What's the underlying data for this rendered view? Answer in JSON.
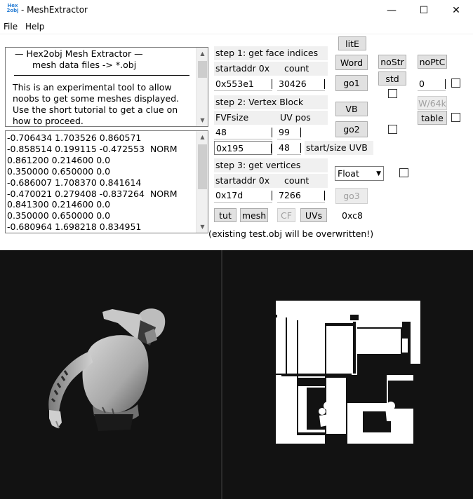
{
  "window": {
    "title": "- MeshExtractor",
    "icon_lines": [
      "Hex",
      "2obj"
    ],
    "controls": [
      "—",
      "☐",
      "✕"
    ]
  },
  "menu": {
    "items": [
      "File",
      "Help"
    ]
  },
  "info": {
    "heading": "—   Hex2obj Mesh Extractor   —",
    "subheading": "mesh data files -> *.obj",
    "body_lines": [
      "This is an experimental tool to allow",
      "noobs to get some meshes displayed.",
      "Use the short tutorial to get a clue on",
      "how to proceed."
    ]
  },
  "data_list": {
    "lines": [
      "-0.706434 1.703526 0.860571",
      "-0.858514 0.199115 -0.472553  NORM",
      "0.861200 0.214600 0.0",
      "0.350000 0.650000 0.0",
      "-0.686007 1.708370 0.841614",
      "-0.470021 0.279408 -0.837264  NORM",
      "0.841300 0.214600 0.0",
      "0.350000 0.650000 0.0",
      "-0.680964 1.698218 0.834951"
    ]
  },
  "step1": {
    "label": "step 1: get face indices",
    "addr_label": "startaddr 0x",
    "count_label": "count",
    "addr_value": "0x553e1",
    "count_value": "30426"
  },
  "step2": {
    "label": "step 2: Vertex Block",
    "fvf_label": "FVFsize",
    "uv_label": "UV pos",
    "fvf_value": "48",
    "uv_value": "99",
    "uvb_start_value": "0x195",
    "uvb_size_value": "48",
    "uvb_label": "start/size UVB"
  },
  "step3": {
    "label": "step 3: get vertices",
    "addr_label": "startaddr 0x",
    "count_label": "count",
    "addr_value": "0x17d",
    "count_value": "7266",
    "format_value": "Float"
  },
  "buttons": {
    "lite": "litE",
    "word": "Word",
    "go1": "go1",
    "vb": "VB",
    "go2": "go2",
    "go3": "go3",
    "nostr": "noStr",
    "std": "std",
    "noptc": "noPtC",
    "w64k": "W/64k",
    "table": "table",
    "tut": "tut",
    "mesh": "mesh",
    "cf": "CF",
    "uvs": "UVs"
  },
  "side_value": "0",
  "hex_readout": "0xc8",
  "warning": "(existing test.obj will be overwritten!)",
  "colors": {
    "viewport_bg": "#121212",
    "mesh_shade": "#cfcfcf",
    "uv_fill": "#ffffff"
  }
}
